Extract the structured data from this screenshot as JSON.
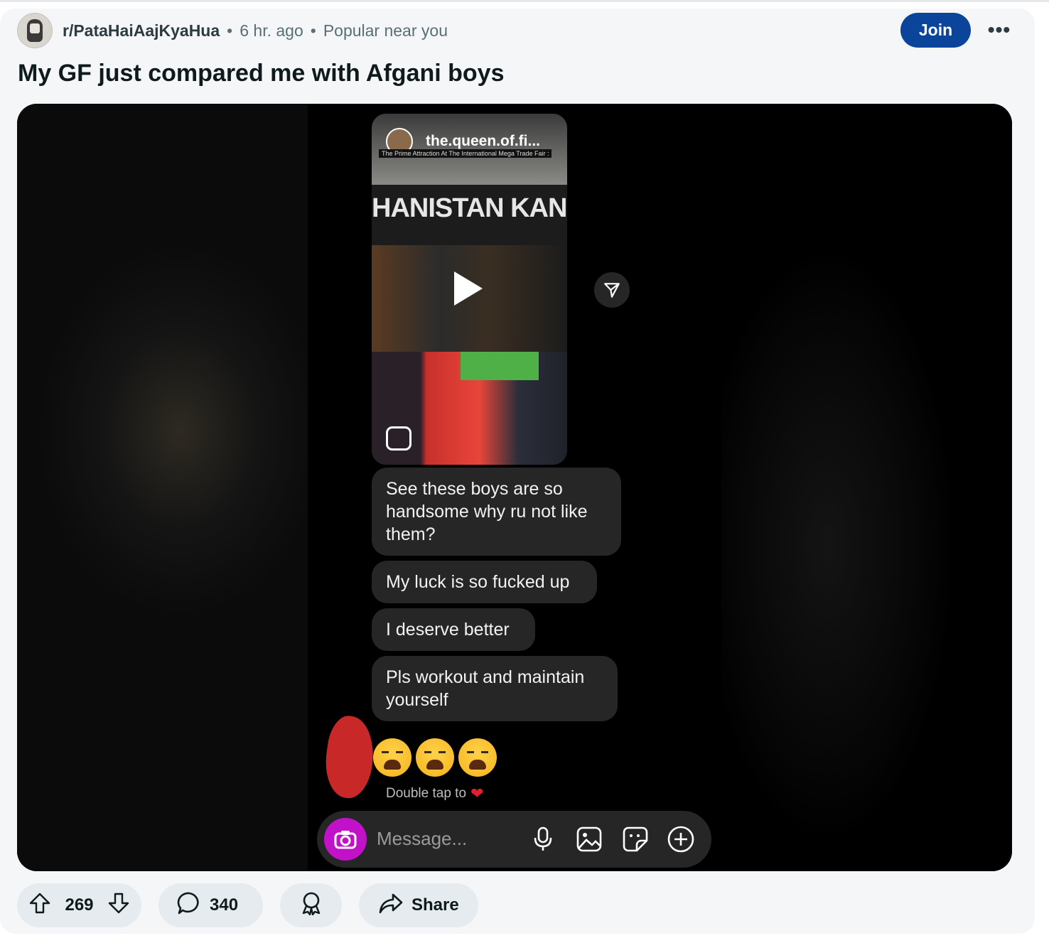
{
  "post": {
    "subreddit": "r/PataHaiAajKyaHua",
    "separator": "•",
    "time": "6 hr. ago",
    "context": "Popular near you",
    "join_label": "Join",
    "more_label": "•••",
    "title": "My GF just compared me with Afgani boys"
  },
  "screenshot": {
    "reel_owner": "the.queen.of.fi...",
    "reel_caption": "The Prime Attraction At The International Mega Trade Fair :",
    "reel_banner": "HANISTAN KANDH",
    "messages": [
      "See these boys are so handsome why ru not like them?",
      "My luck is so fucked up",
      "I deserve better",
      "Pls workout and maintain yourself"
    ],
    "double_tap": "Double tap to",
    "message_placeholder": "Message..."
  },
  "actions": {
    "upvotes": "269",
    "comments": "340",
    "share_label": "Share"
  },
  "colors": {
    "join": "#0a449b",
    "camera": "#c212c9",
    "bubble": "#262626"
  },
  "icons": [
    "upvote-icon",
    "downvote-icon",
    "comment-icon",
    "award-icon",
    "share-icon",
    "send-icon",
    "camera-icon",
    "mic-icon",
    "gallery-icon",
    "sticker-icon",
    "plus-icon",
    "play-icon",
    "reel-icon"
  ]
}
